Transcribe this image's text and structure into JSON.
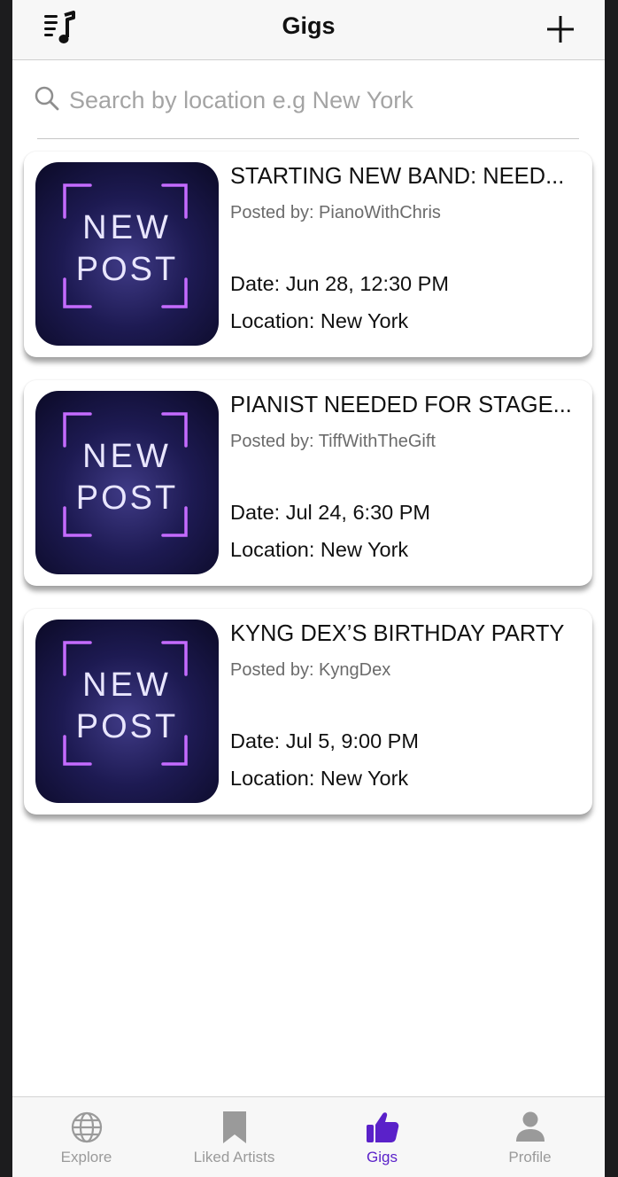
{
  "nav": {
    "title": "Gigs",
    "left_icon": "playlist-music-icon",
    "right_icon": "plus-icon"
  },
  "search": {
    "placeholder": "Search by location e.g New York",
    "value": ""
  },
  "thumbnail": {
    "line1": "NEW",
    "line2": "POST"
  },
  "gigs": [
    {
      "title": "STARTING NEW BAND: NEED...",
      "posted_by": "Posted by: PianoWithChris",
      "date": "Date: Jun 28, 12:30 PM",
      "location": "Location: New York"
    },
    {
      "title": "PIANIST NEEDED FOR STAGE...",
      "posted_by": "Posted by: TiffWithTheGift",
      "date": "Date: Jul 24, 6:30 PM",
      "location": "Location: New York"
    },
    {
      "title": "KYNG DEX’S BIRTHDAY PARTY",
      "posted_by": "Posted by: KyngDex",
      "date": "Date: Jul 5, 9:00 PM",
      "location": "Location: New York"
    }
  ],
  "tabbar": {
    "items": [
      {
        "label": "Explore",
        "icon": "globe-icon"
      },
      {
        "label": "Liked Artists",
        "icon": "bookmark-icon"
      },
      {
        "label": "Gigs",
        "icon": "thumbs-up-icon"
      },
      {
        "label": "Profile",
        "icon": "person-icon"
      }
    ],
    "active_index": 2
  },
  "colors": {
    "accent": "#5a21c9",
    "inactive": "#9a9a9a",
    "neon_purple": "#b94bff"
  }
}
